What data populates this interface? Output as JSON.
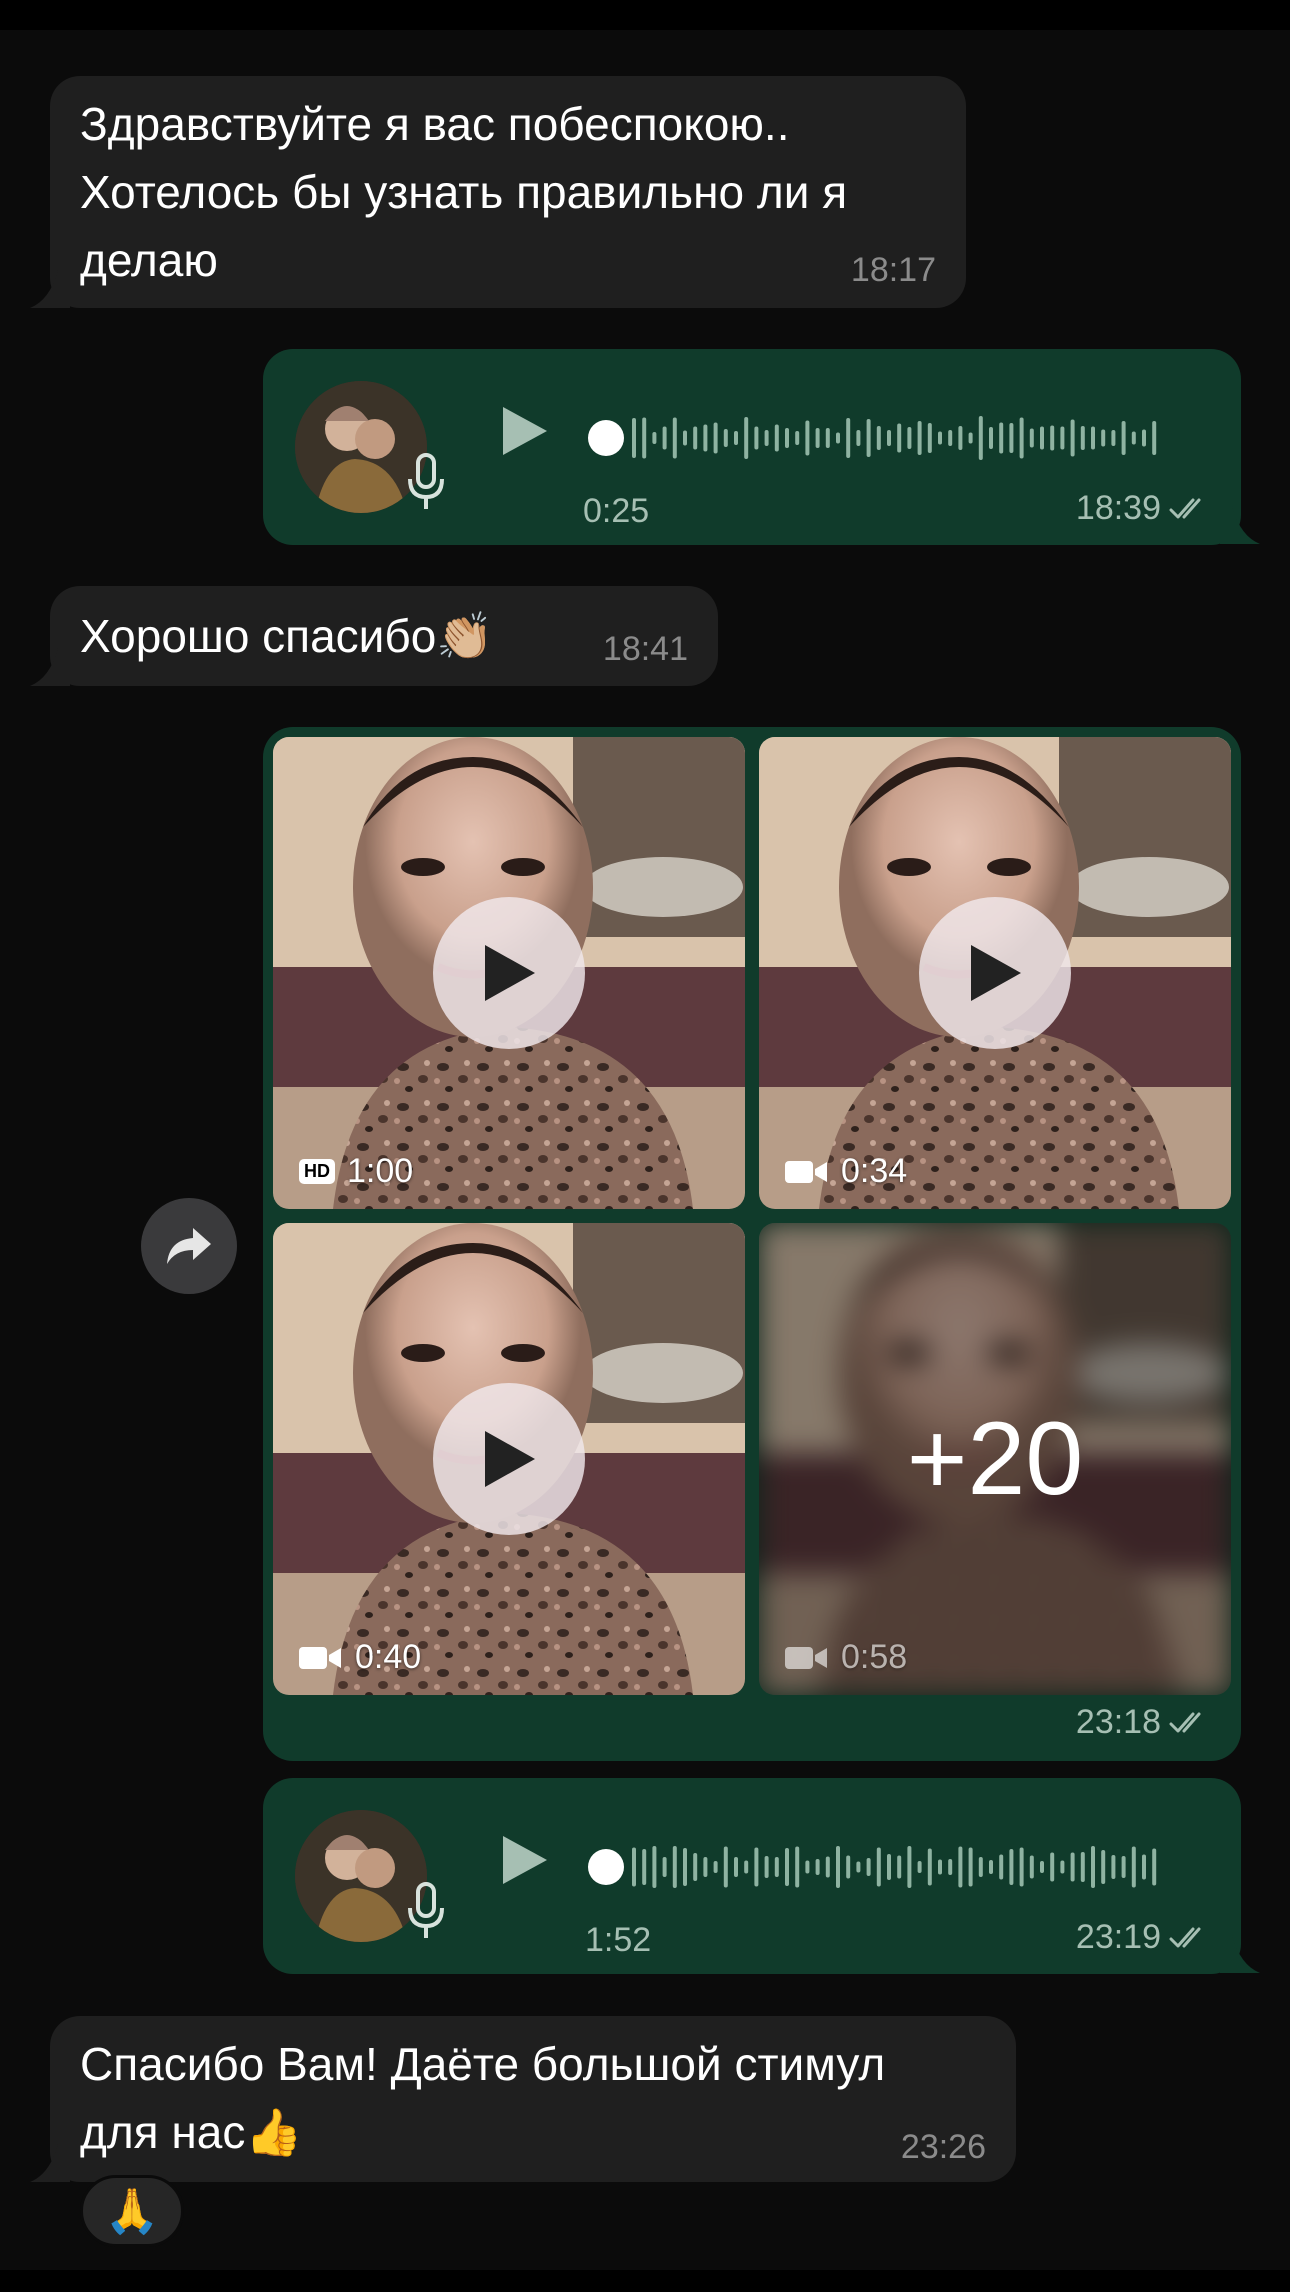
{
  "messages": {
    "m1": {
      "text": "Здравствуйте я вас побеспокою..\nХотелось бы узнать правильно ли я\nделаю",
      "time": "18:17"
    },
    "m2": {
      "type": "voice",
      "duration": "0:25",
      "time": "18:39",
      "progress": 0
    },
    "m3": {
      "text": "Хорошо спасибо👏🏼",
      "time": "18:41"
    },
    "m4": {
      "type": "media-album",
      "time": "23:18",
      "tiles": [
        {
          "badge": "1:00",
          "hd_label": "HD"
        },
        {
          "badge": "0:34"
        },
        {
          "badge": "0:40"
        },
        {
          "badge": "0:58",
          "more": "+20"
        }
      ]
    },
    "m5": {
      "type": "voice",
      "duration": "1:52",
      "time": "23:19",
      "progress": 0
    },
    "m6": {
      "text": "Спасибо Вам! Даёте большой стимул\nдля нас👍",
      "time": "23:26",
      "reaction": "🙏"
    }
  },
  "icons": {
    "play": "play-icon",
    "mic": "mic-icon",
    "forward": "forward-icon",
    "read": "double-check-icon",
    "video": "video-camera-icon"
  },
  "colors": {
    "incoming": "#1f1f1f",
    "outgoing": "#103b2b",
    "background": "#0b0b0b",
    "meta_out": "#a6bfb3"
  }
}
